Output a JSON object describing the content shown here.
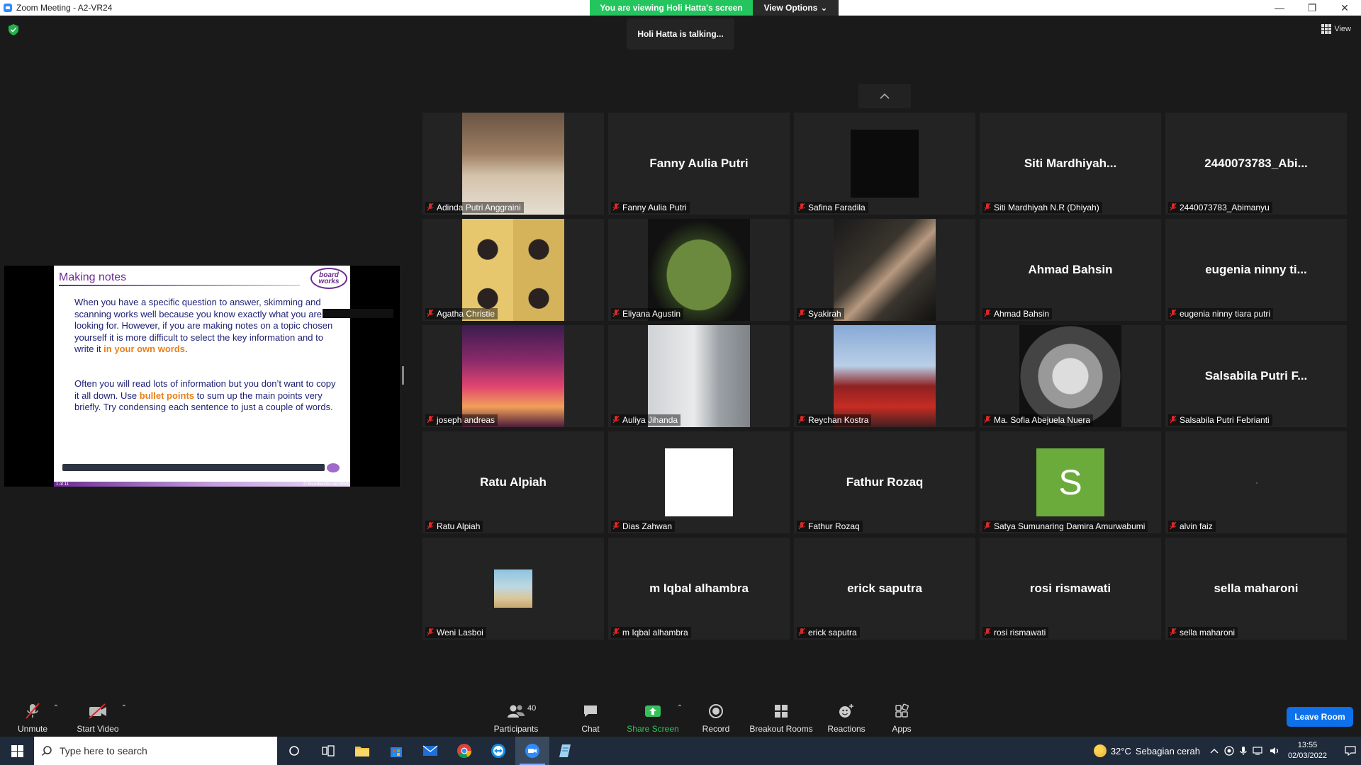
{
  "window": {
    "title": "Zoom Meeting - A2-VR24",
    "minimize": "—",
    "restore": "❐",
    "close": "✕"
  },
  "banner": {
    "viewing_text": "You are viewing Holi Hatta's screen",
    "view_options_label": "View Options",
    "view_options_caret": "⌄"
  },
  "talking_indicator": "Holi Hatta is talking...",
  "view_button": "View",
  "slide": {
    "title": "Making notes",
    "logo_top": "board",
    "logo_bottom": "works",
    "para1_pre": "When you have a specific question to answer, skimming and scanning works well because you know exactly what you are looking for. However, if you are making notes on a topic chosen yourself it is more difficult to select the key information and to write it ",
    "para1_highlight": "in your own words",
    "para1_post": ".",
    "para2_pre": "Often you will read lots of information but you don’t want to copy it all down. Use ",
    "para2_highlight": "bullet points",
    "para2_post": " to sum up the main points very briefly. Try condensing each sentence to just a couple of words.",
    "footer_left": "1 of 11",
    "footer_right": "© Boardworks Ltd 2003"
  },
  "participants": [
    {
      "label": "Adinda Putri Anggraini",
      "display": "",
      "media": "room"
    },
    {
      "label": "Fanny Aulia Putri",
      "display": "Fanny Aulia Putri",
      "media": "none"
    },
    {
      "label": "Safina Faradila",
      "display": "",
      "media": "stars"
    },
    {
      "label": "Siti Mardhiyah N.R (Dhiyah)",
      "display": "Siti  Mardhiyah...",
      "media": "none"
    },
    {
      "label": "2440073783_Abimanyu",
      "display": "2440073783_Abi...",
      "media": "none"
    },
    {
      "label": "Agatha Christie",
      "display": "",
      "media": "girls"
    },
    {
      "label": "Eliyana Agustin",
      "display": "",
      "media": "window"
    },
    {
      "label": "Syakirah",
      "display": "",
      "media": "hand"
    },
    {
      "label": "Ahmad Bahsin",
      "display": "Ahmad Bahsin",
      "media": "none"
    },
    {
      "label": "eugenia ninny tiara putri",
      "display": "eugenia  ninny  ti...",
      "media": "none"
    },
    {
      "label": "joseph andreas",
      "display": "",
      "media": "sunset"
    },
    {
      "label": "Auliya Jihanda",
      "display": "",
      "media": "building"
    },
    {
      "label": "Reychan Kostra",
      "display": "",
      "media": "f1"
    },
    {
      "label": "Ma. Sofia Abejuela Nuera",
      "display": "",
      "media": "flower"
    },
    {
      "label": "Salsabila Putri Febrianti",
      "display": "Salsabila  Putri  F...",
      "media": "none"
    },
    {
      "label": "Ratu Alpiah",
      "display": "Ratu Alpiah",
      "media": "none"
    },
    {
      "label": "Dias Zahwan",
      "display": "",
      "media": "cat"
    },
    {
      "label": "Fathur Rozaq",
      "display": "Fathur Rozaq",
      "media": "none"
    },
    {
      "label": "Satya Sumunaring Damira Amurwabumi",
      "display": "",
      "media": "avatar-s",
      "avatar_letter": "S"
    },
    {
      "label": "alvin faiz",
      "display": "",
      "media": "dot"
    },
    {
      "label": "Weni Lasboi",
      "display": "",
      "media": "beach"
    },
    {
      "label": "m Iqbal alhambra",
      "display": "m Iqbal alhambra",
      "media": "none"
    },
    {
      "label": "erick saputra",
      "display": "erick saputra",
      "media": "none"
    },
    {
      "label": "rosi rismawati",
      "display": "rosi rismawati",
      "media": "none"
    },
    {
      "label": "sella maharoni",
      "display": "sella maharoni",
      "media": "none"
    }
  ],
  "toolbar": {
    "unmute": "Unmute",
    "start_video": "Start Video",
    "participants": "Participants",
    "participants_count": "40",
    "chat": "Chat",
    "share_screen": "Share Screen",
    "record": "Record",
    "breakout_rooms": "Breakout Rooms",
    "reactions": "Reactions",
    "apps": "Apps",
    "leave": "Leave Room"
  },
  "taskbar": {
    "search_placeholder": "Type here to search",
    "weather_temp": "32°C",
    "weather_desc": "Sebagian cerah",
    "time": "13:55",
    "date": "02/03/2022"
  },
  "colors": {
    "accent_green": "#24c45e",
    "leave_blue": "#0e71eb",
    "mic_off_red": "#e02828",
    "slide_purple": "#6b2c91",
    "slide_orange": "#e8801c"
  }
}
